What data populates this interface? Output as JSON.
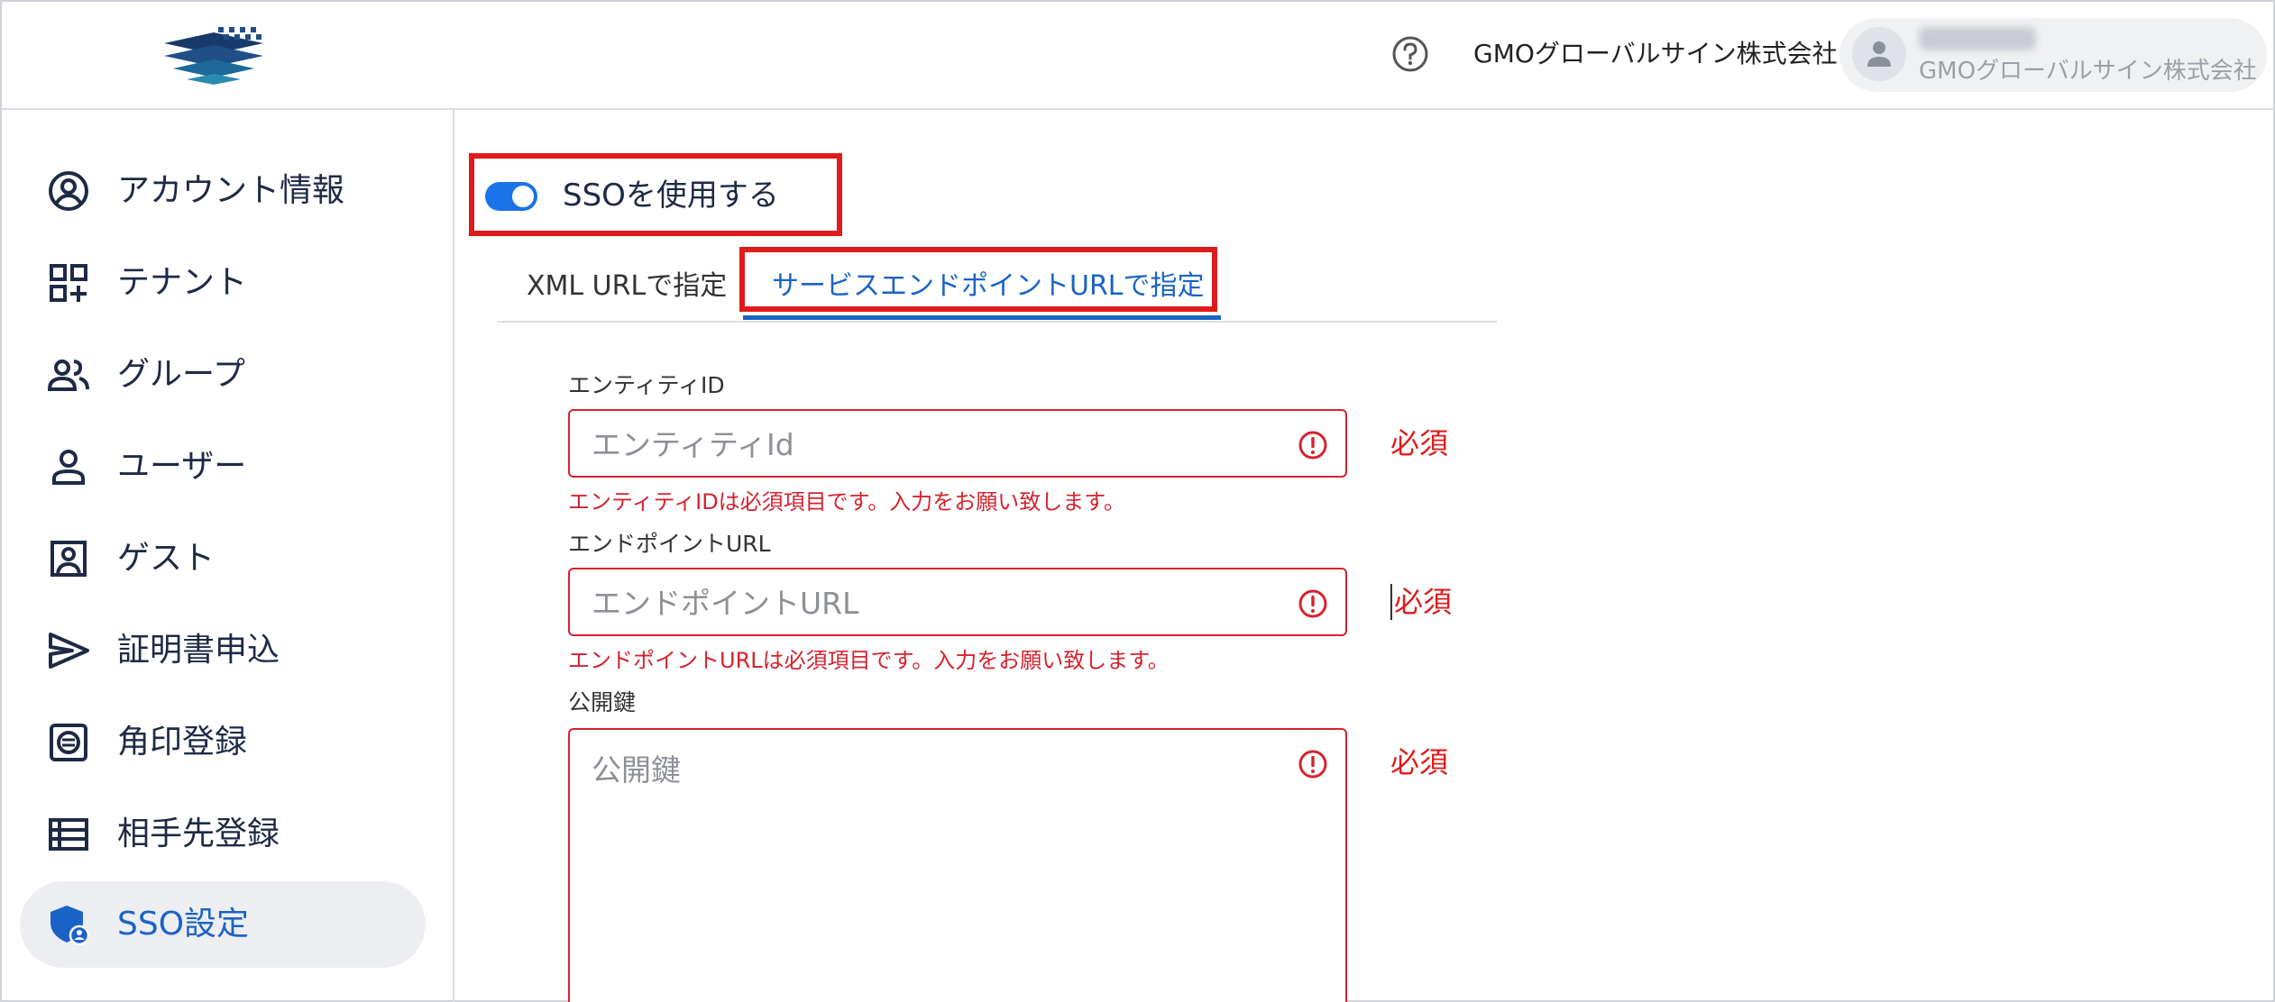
{
  "header": {
    "help_icon": "help-circle-icon",
    "company_name": "GMOグローバルサイン株式会社",
    "user": {
      "company": "GMOグローバルサイン株式会社"
    }
  },
  "sidebar": {
    "items": [
      {
        "label": "アカウント情報",
        "icon": "account-circle-icon",
        "active": false
      },
      {
        "label": "テナント",
        "icon": "dashboard-add-icon",
        "active": false
      },
      {
        "label": "グループ",
        "icon": "group-icon",
        "active": false
      },
      {
        "label": "ユーザー",
        "icon": "person-icon",
        "active": false
      },
      {
        "label": "ゲスト",
        "icon": "contact-card-icon",
        "active": false
      },
      {
        "label": "証明書申込",
        "icon": "send-icon",
        "active": false
      },
      {
        "label": "角印登録",
        "icon": "stamp-icon",
        "active": false
      },
      {
        "label": "相手先登録",
        "icon": "list-icon",
        "active": false
      },
      {
        "label": "SSO設定",
        "icon": "shield-user-icon",
        "active": true
      }
    ]
  },
  "sso": {
    "toggle_label": "SSOを使用する",
    "toggle_on": true,
    "tabs": [
      {
        "label": "XML URLで指定",
        "active": false
      },
      {
        "label": "サービスエンドポイントURLで指定",
        "active": true
      }
    ],
    "fields": [
      {
        "label": "エンティティID",
        "placeholder": "エンティティId",
        "value": "",
        "error": "エンティティIDは必須項目です。入力をお願い致します。",
        "required": "必須"
      },
      {
        "label": "エンドポイントURL",
        "placeholder": "エンドポイントURL",
        "value": "",
        "error": "エンドポイントURLは必須項目です。入力をお願い致します。",
        "required": "必須"
      },
      {
        "label": "公開鍵",
        "placeholder": "公開鍵",
        "value": "",
        "error": "",
        "required": "必須"
      }
    ]
  },
  "colors": {
    "accent": "#1a63c6",
    "toggle": "#1a73e8",
    "error": "#d6232f",
    "highlight_box": "#e01b1b",
    "nav_text": "#1e2a45"
  }
}
